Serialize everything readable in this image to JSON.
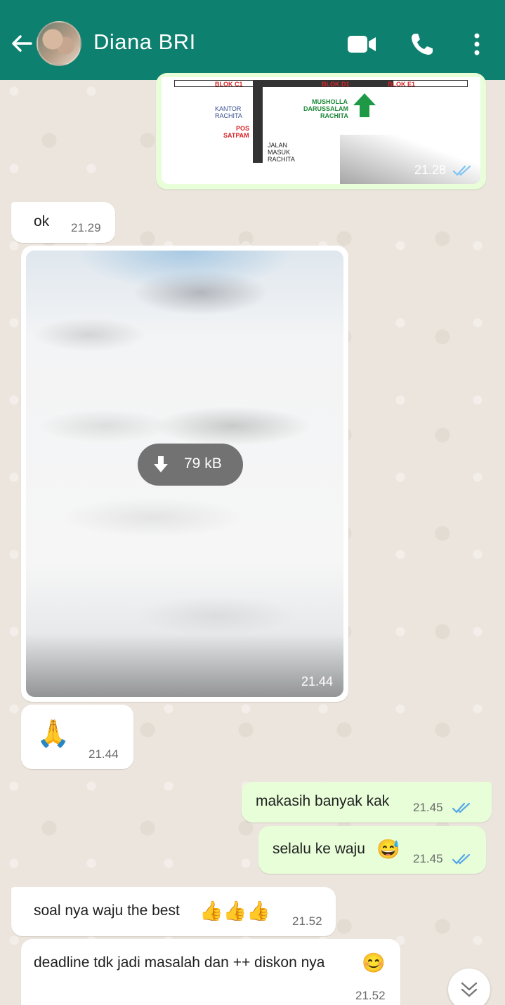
{
  "header": {
    "contact_name": "Diana BRI",
    "icons": [
      "back-arrow-icon",
      "avatar",
      "video-call-icon",
      "voice-call-icon",
      "more-options-icon"
    ]
  },
  "map_message": {
    "labels": {
      "blok_c1": "BLOK C1",
      "blok_d1": "BLOK D1",
      "blok_e1": "BLOK E1",
      "kantor": "KANTOR",
      "rachita1": "RACHITA",
      "pos": "POS",
      "satpam": "SATPAM",
      "musholla": "MUSHOLLA",
      "darussalam": "DARUSSALAM",
      "rachita2": "RACHITA",
      "jalan": "JALAN",
      "masuk": "MASUK",
      "rachita3": "RACHITA"
    },
    "time": "21.28"
  },
  "messages": [
    {
      "id": "m1",
      "text": "ok",
      "time": "21.29"
    },
    {
      "id": "m2",
      "download_size": "79 kB",
      "time": "21.44"
    },
    {
      "id": "m3",
      "emoji": "🙏",
      "time": "21.44"
    },
    {
      "id": "m4",
      "text": "makasih banyak kak",
      "time": "21.45"
    },
    {
      "id": "m5",
      "text": "selalu ke waju",
      "emoji": "😅",
      "time": "21.45"
    },
    {
      "id": "m6",
      "text": "soal nya waju the best",
      "emoji": "👍👍👍",
      "time": "21.52"
    },
    {
      "id": "m7",
      "text": "deadline tdk jadi masalah dan ++ diskon nya",
      "emoji": "😊",
      "time": "21.52"
    }
  ],
  "colors": {
    "header": "#0e806f",
    "outgoing_bubble": "#e7fed8",
    "incoming_bubble": "#ffffff",
    "read_ticks": "#53a6e8"
  }
}
